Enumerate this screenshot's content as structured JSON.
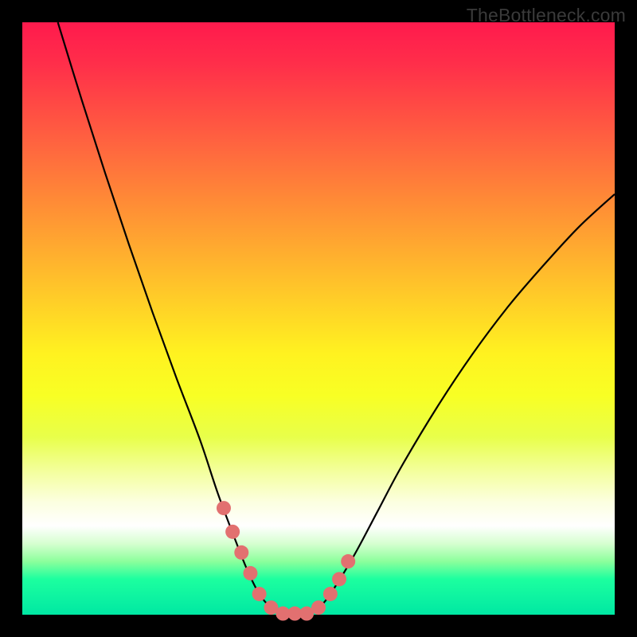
{
  "watermark": "TheBottleneck.com",
  "chart_data": {
    "type": "line",
    "title": "",
    "xlabel": "",
    "ylabel": "",
    "xlim": [
      0,
      100
    ],
    "ylim": [
      0,
      100
    ],
    "grid": false,
    "legend": false,
    "series": [
      {
        "name": "curve",
        "x": [
          6,
          10,
          14,
          18,
          22,
          26,
          30,
          33,
          36,
          38,
          40,
          42,
          44,
          48,
          50,
          52,
          56,
          60,
          64,
          70,
          76,
          82,
          88,
          94,
          100
        ],
        "values": [
          100,
          87,
          74.5,
          62.5,
          51,
          40,
          29.5,
          20.5,
          12.5,
          7.5,
          3.5,
          1.2,
          0.2,
          0.2,
          1.2,
          3.5,
          10,
          17.5,
          25,
          35,
          44,
          52,
          59,
          65.5,
          71
        ]
      }
    ],
    "markers": {
      "name": "highlight-dots",
      "x": [
        34,
        35.5,
        37,
        38.5,
        40,
        42,
        44,
        46,
        48,
        50,
        52,
        53.5,
        55
      ],
      "values": [
        18,
        14,
        10.5,
        7,
        3.5,
        1.2,
        0.2,
        0.2,
        0.2,
        1.2,
        3.5,
        6,
        9
      ]
    },
    "gradient_stops": [
      {
        "pos": 0,
        "color": "#ff1a4d"
      },
      {
        "pos": 50,
        "color": "#ffe020"
      },
      {
        "pos": 85,
        "color": "#ffffff"
      },
      {
        "pos": 100,
        "color": "#00e8a3"
      }
    ]
  }
}
